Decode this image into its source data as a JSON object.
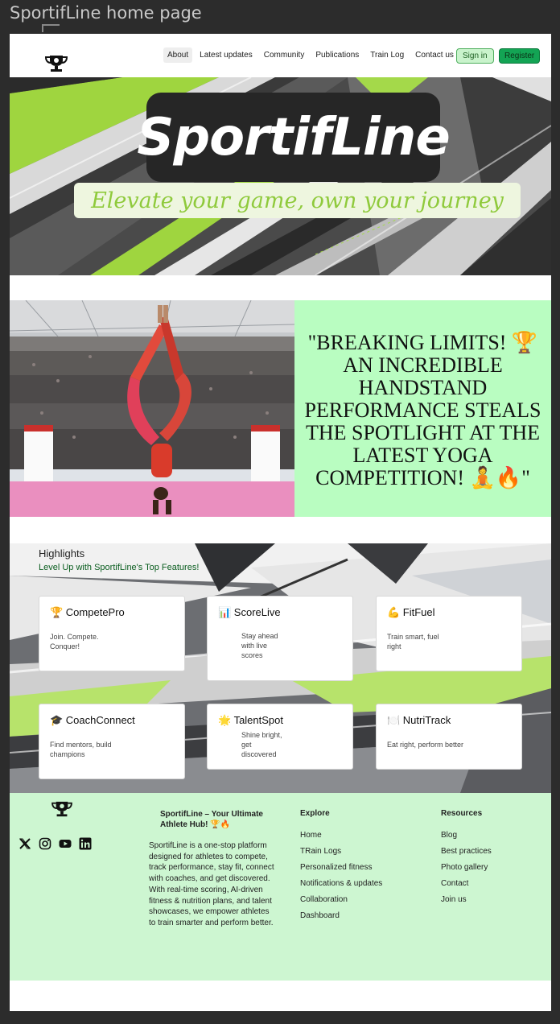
{
  "frame": {
    "title": "SportifLine home page"
  },
  "header": {
    "nav": [
      "About",
      "Latest updates",
      "Community",
      "Publications",
      "Train Log",
      "Contact us"
    ],
    "signin_label": "Sign in",
    "register_label": "Register"
  },
  "hero": {
    "brand": "SportifLine",
    "tagline": "Elevate your game, own your journey"
  },
  "story": {
    "headline": "\"BREAKING LIMITS! 🏆 AN INCREDIBLE HANDSTAND PERFORMANCE STEALS THE SPOTLIGHT AT THE LATEST YOGA COMPETITION! 🧘🔥\""
  },
  "highlights": {
    "title": "Highlights",
    "subtitle": "Level Up with SportifLine's Top Features!",
    "cards": [
      {
        "title": "🏆 CompetePro",
        "desc": "Join. Compete. Conquer!"
      },
      {
        "title": "📊 ScoreLive",
        "desc": "Stay ahead with live scores"
      },
      {
        "title": "💪 FitFuel",
        "desc": "Train smart, fuel right"
      },
      {
        "title": "🎓 CoachConnect",
        "desc": "Find mentors, build champions"
      },
      {
        "title": "🌟 TalentSpot",
        "desc": "Shine bright, get discovered"
      },
      {
        "title": "🍽️ NutriTrack",
        "desc": "Eat right, perform better"
      }
    ]
  },
  "footer": {
    "headline": "SportifLine – Your Ultimate Athlete Hub! 🏆🔥",
    "about": "SportifLine is a one-stop platform designed for athletes to compete, track performance, stay fit, connect with coaches, and get discovered. With real-time scoring, AI-driven fitness & nutrition plans, and talent showcases, we empower athletes to train smarter and perform better.",
    "explore": {
      "title": "Explore",
      "links": [
        "Home",
        "TRain Logs",
        "Personalized fitness",
        "Notifications & updates",
        "Collaboration",
        "Dashboard"
      ]
    },
    "resources": {
      "title": "Resources",
      "links": [
        "Blog",
        "Best practices",
        "Photo gallery",
        "Contact",
        "Join us"
      ]
    },
    "socials": [
      "x-icon",
      "instagram-icon",
      "youtube-icon",
      "linkedin-icon"
    ]
  }
}
